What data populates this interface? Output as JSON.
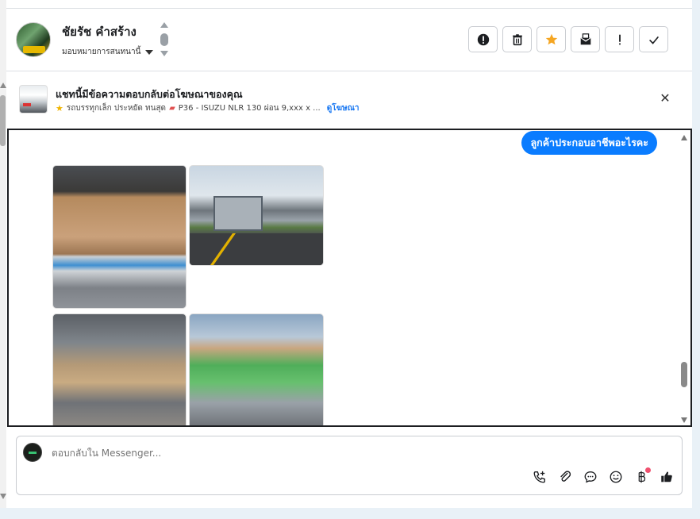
{
  "header": {
    "contact_name": "ชัยรัช คำสร้าง",
    "assign_label": "มอบหมายการสนทนานี้",
    "actions": [
      {
        "name": "report-icon",
        "label": "!"
      },
      {
        "name": "trash-icon",
        "label": ""
      },
      {
        "name": "star-icon",
        "label": ""
      },
      {
        "name": "mark-unread-icon",
        "label": ""
      },
      {
        "name": "follow-up-icon",
        "label": "!"
      },
      {
        "name": "check-icon",
        "label": ""
      }
    ],
    "star_color": "#f5a623"
  },
  "ad": {
    "title": "แชทนี้มีข้อความตอบกลับต่อโฆษณาของคุณ",
    "subtitle": "รถบรรทุกเล็ก ประหยัด ทนสุด",
    "detail": "P36 - ISUZU NLR 130 ผ่อน 9,xxx x ...",
    "link": "ดูโฆษณา"
  },
  "thread": {
    "bubble_text": "ลูกค้าประกอบอาชีพอะไรคะ",
    "bubble_color": "#0a7cff",
    "photos": [
      "photo-1",
      "photo-2",
      "photo-3",
      "photo-4"
    ]
  },
  "composer": {
    "placeholder": "ตอบกลับใน Messenger...",
    "tools": [
      "call-add-icon",
      "attachment-icon",
      "chat-bubble-icon",
      "emoji-icon",
      "baht-icon",
      "thumbs-up-icon"
    ],
    "badge_color": "#f0506e"
  }
}
